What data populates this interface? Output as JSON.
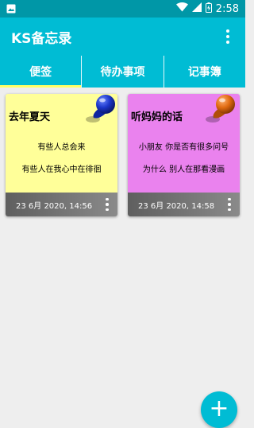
{
  "status_bar": {
    "time": "2:58",
    "icons": [
      "image-icon",
      "wifi-icon",
      "signal-icon",
      "battery-icon"
    ]
  },
  "app_bar": {
    "title": "KS备忘录",
    "menu_icon": "more-vert-icon"
  },
  "tabs": [
    {
      "label": "便签",
      "active": true
    },
    {
      "label": "待办事项",
      "active": false
    },
    {
      "label": "记事簿",
      "active": false
    }
  ],
  "notes": [
    {
      "title": "去年夏天",
      "lines": [
        "有些人总会来",
        "有些人在我心中在徘徊"
      ],
      "date": "23 6月 2020, 14:56",
      "color": "#ffff99",
      "pin_color": "#1a35c9"
    },
    {
      "title": "听妈妈的话",
      "lines": [
        "小朋友 你是否有很多问号",
        "为什么 别人在那看漫画"
      ],
      "date": "23 6月 2020, 14:58",
      "color": "#ea82ee",
      "pin_color": "#e06a10"
    }
  ],
  "fab": {
    "label": "+",
    "icon": "add-icon"
  },
  "colors": {
    "status_bar": "#0097a7",
    "app_bar": "#00bcd4",
    "tab_indicator": "#ffff66",
    "note_footer": "#6b6b6b"
  }
}
